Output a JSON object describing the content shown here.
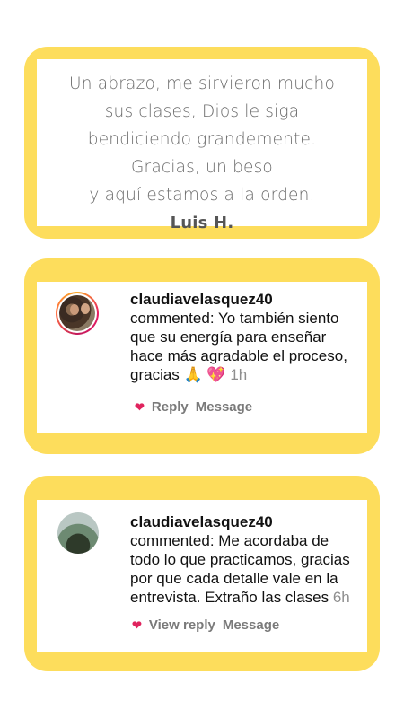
{
  "quote_card": {
    "lines": [
      "Un abrazo, me sirvieron mucho",
      "sus clases, Dios le siga",
      "bendiciendo grandemente.",
      "Gracias, un beso",
      "y aquí estamos a la orden."
    ],
    "author": "Luis H."
  },
  "comments": [
    {
      "username": "claudiavelasquez40",
      "lines": [
        "commented: Yo también siento",
        "que su energía para enseñar",
        "hace más agradable el proceso,"
      ],
      "last_line": "gracias 🙏 💖",
      "time": "1h",
      "reply_label": "Reply",
      "message_label": "Message"
    },
    {
      "username": "claudiavelasquez40",
      "lines": [
        "commented: Me acordaba de",
        "todo lo que practicamos, gracias",
        "por que cada detalle vale en la"
      ],
      "last_line": "entrevista. Extraño las clases",
      "time": "6h",
      "reply_label": "View reply",
      "message_label": "Message"
    }
  ],
  "colors": {
    "card_border": "#FDDD5C",
    "heart": "#e0245e"
  }
}
